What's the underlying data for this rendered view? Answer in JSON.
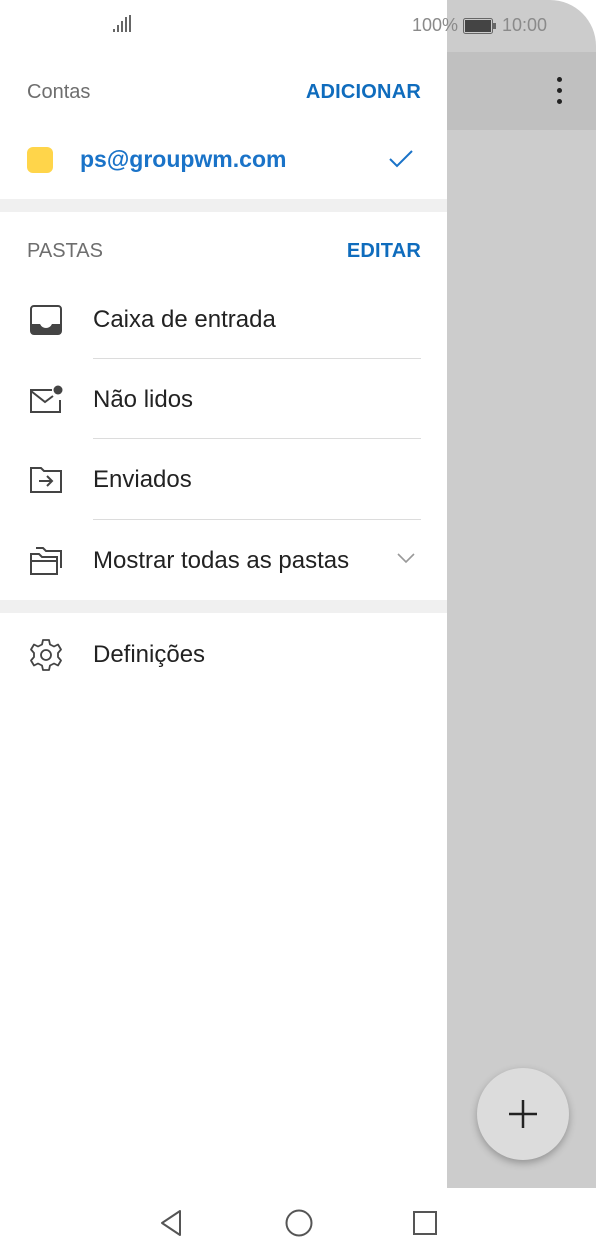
{
  "status_bar": {
    "battery_percent": "100%",
    "time": "10:00",
    "icons": [
      "signal-icon",
      "battery-icon"
    ]
  },
  "accounts": {
    "title": "Contas",
    "add_label": "ADICIONAR",
    "items": [
      {
        "email": "ps@groupwm.com",
        "color": "#ffd54a",
        "selected": true
      }
    ]
  },
  "folders": {
    "title": "PASTAS",
    "edit_label": "EDITAR",
    "items": [
      {
        "label": "Caixa de entrada",
        "icon": "inbox-icon"
      },
      {
        "label": "Não lidos",
        "icon": "unread-mail-icon"
      },
      {
        "label": "Enviados",
        "icon": "sent-folder-icon"
      },
      {
        "label": "Mostrar todas as pastas",
        "icon": "folders-icon",
        "expandable": true
      }
    ]
  },
  "settings": {
    "label": "Definições",
    "icon": "gear-icon"
  },
  "background_app": {
    "icons": [
      "overflow-menu-icon",
      "compose-plus-icon"
    ]
  },
  "nav_bar": {
    "icons": [
      "back-icon",
      "home-icon",
      "recents-icon"
    ]
  },
  "colors": {
    "accent": "#0f6cbd",
    "link": "#1a73c8",
    "scrim": "#cccccc"
  }
}
